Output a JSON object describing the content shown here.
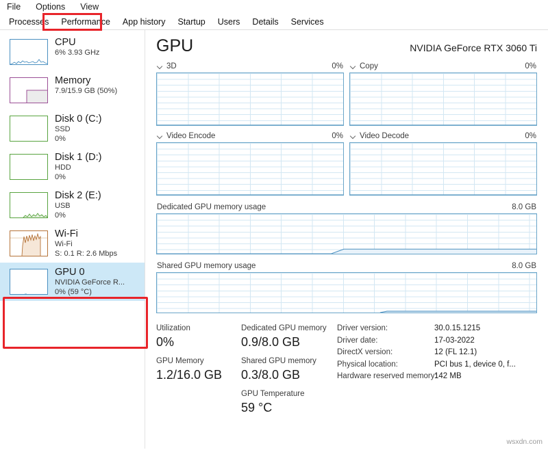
{
  "window": {
    "menu": [
      {
        "label": "File",
        "name": "menu-file"
      },
      {
        "label": "Options",
        "name": "menu-options"
      },
      {
        "label": "View",
        "name": "menu-view"
      }
    ],
    "tabs": [
      {
        "label": "Processes",
        "name": "tab-processes",
        "active": false
      },
      {
        "label": "Performance",
        "name": "tab-performance",
        "active": true
      },
      {
        "label": "App history",
        "name": "tab-app-history",
        "active": false
      },
      {
        "label": "Startup",
        "name": "tab-startup",
        "active": false
      },
      {
        "label": "Users",
        "name": "tab-users",
        "active": false
      },
      {
        "label": "Details",
        "name": "tab-details",
        "active": false
      },
      {
        "label": "Services",
        "name": "tab-services",
        "active": false
      }
    ],
    "annotation_color": "#e8242a",
    "watermark": "wsxdn.com"
  },
  "sidebar": {
    "items": [
      {
        "name": "sidebar-item-cpu",
        "title": "CPU",
        "sub1": "6%  3.93 GHz",
        "sub2": "",
        "accent": "#4a8fc0",
        "fill": "#cfe4f2",
        "selected": false,
        "graph": "spiky-low"
      },
      {
        "name": "sidebar-item-memory",
        "title": "Memory",
        "sub1": "7.9/15.9 GB (50%)",
        "sub2": "",
        "accent": "#9b4f96",
        "fill": "#ececec",
        "selected": false,
        "graph": "memory-block"
      },
      {
        "name": "sidebar-item-disk0",
        "title": "Disk 0 (C:)",
        "sub1": "SSD",
        "sub2": "0%",
        "accent": "#58a33f",
        "fill": "#e3f0dd",
        "selected": false,
        "graph": "flat"
      },
      {
        "name": "sidebar-item-disk1",
        "title": "Disk 1 (D:)",
        "sub1": "HDD",
        "sub2": "0%",
        "accent": "#58a33f",
        "fill": "#e3f0dd",
        "selected": false,
        "graph": "flat"
      },
      {
        "name": "sidebar-item-disk2",
        "title": "Disk 2 (E:)",
        "sub1": "USB",
        "sub2": "0%",
        "accent": "#58a33f",
        "fill": "#e3f0dd",
        "selected": false,
        "graph": "small-bumps"
      },
      {
        "name": "sidebar-item-wifi",
        "title": "Wi-Fi",
        "sub1": "Wi-Fi",
        "sub2": "S: 0.1 R: 2.6 Mbps",
        "accent": "#b5743a",
        "fill": "#f6e7d8",
        "selected": false,
        "graph": "wifi-burst"
      },
      {
        "name": "sidebar-item-gpu0",
        "title": "GPU 0",
        "sub1": "NVIDIA GeForce R...",
        "sub2": "0%  (59 °C)",
        "accent": "#4a8fc0",
        "fill": "#cfe4f2",
        "selected": true,
        "graph": "flat"
      }
    ]
  },
  "main": {
    "title": "GPU",
    "device": "NVIDIA GeForce RTX 3060 Ti",
    "engine_graphs": [
      {
        "name": "graph-3d",
        "label": "3D",
        "value": "0%"
      },
      {
        "name": "graph-copy",
        "label": "Copy",
        "value": "0%"
      },
      {
        "name": "graph-video-encode",
        "label": "Video Encode",
        "value": "0%"
      },
      {
        "name": "graph-video-decode",
        "label": "Video Decode",
        "value": "0%"
      }
    ],
    "memory_graphs": [
      {
        "name": "graph-dedicated-gpu-memory",
        "label": "Dedicated GPU memory usage",
        "max": "8.0 GB"
      },
      {
        "name": "graph-shared-gpu-memory",
        "label": "Shared GPU memory usage",
        "max": "8.0 GB"
      }
    ],
    "stats_col1": [
      {
        "name": "stat-utilization",
        "label": "Utilization",
        "value": "0%"
      },
      {
        "name": "stat-gpu-memory",
        "label": "GPU Memory",
        "value": "1.2/16.0 GB"
      }
    ],
    "stats_col2": [
      {
        "name": "stat-dedicated-gpu-memory",
        "label": "Dedicated GPU memory",
        "value": "0.9/8.0 GB"
      },
      {
        "name": "stat-shared-gpu-memory",
        "label": "Shared GPU memory",
        "value": "0.3/8.0 GB"
      },
      {
        "name": "stat-gpu-temperature",
        "label": "GPU Temperature",
        "value": "59 °C"
      }
    ],
    "details": [
      {
        "name": "detail-driver-version",
        "key": "Driver version:",
        "value": "30.0.15.1215"
      },
      {
        "name": "detail-driver-date",
        "key": "Driver date:",
        "value": "17-03-2022"
      },
      {
        "name": "detail-directx-version",
        "key": "DirectX version:",
        "value": "12 (FL 12.1)"
      },
      {
        "name": "detail-physical-location",
        "key": "Physical location:",
        "value": "PCI bus 1, device 0, f..."
      },
      {
        "name": "detail-hardware-reserved-memory",
        "key": "Hardware reserved memory:",
        "value": "142 MB"
      }
    ]
  },
  "chart_data": {
    "type": "line",
    "title": "GPU performance graphs",
    "panels": [
      {
        "label": "3D",
        "ylim": [
          0,
          100
        ],
        "ylabel": "%",
        "current": 0,
        "values": [
          0,
          0,
          0,
          0,
          0,
          0,
          0,
          0,
          0,
          0,
          0,
          0,
          0,
          0,
          0,
          0,
          0,
          0,
          0,
          0
        ]
      },
      {
        "label": "Copy",
        "ylim": [
          0,
          100
        ],
        "ylabel": "%",
        "current": 0,
        "values": [
          0,
          0,
          0,
          0,
          0,
          0,
          0,
          0,
          0,
          0,
          0,
          0,
          0,
          0,
          0,
          0,
          0,
          0,
          0,
          0
        ]
      },
      {
        "label": "Video Encode",
        "ylim": [
          0,
          100
        ],
        "ylabel": "%",
        "current": 0,
        "values": [
          0,
          0,
          0,
          0,
          0,
          0,
          0,
          0,
          0,
          0,
          0,
          0,
          0,
          0,
          0,
          0,
          0,
          0,
          0,
          0
        ]
      },
      {
        "label": "Video Decode",
        "ylim": [
          0,
          100
        ],
        "ylabel": "%",
        "current": 0,
        "values": [
          0,
          0,
          0,
          0,
          0,
          0,
          0,
          0,
          0,
          0,
          0,
          0,
          0,
          0,
          0,
          0,
          0,
          0,
          0,
          0
        ]
      },
      {
        "label": "Dedicated GPU memory usage",
        "ylim": [
          0,
          8
        ],
        "ylabel": "GB",
        "current": 0.9,
        "values": [
          0,
          0,
          0,
          0,
          0,
          0,
          0,
          0,
          0,
          0,
          0.9,
          0.9,
          0.9,
          0.9,
          0.9,
          0.9,
          0.9,
          0.9,
          0.9,
          0.9
        ]
      },
      {
        "label": "Shared GPU memory usage",
        "ylim": [
          0,
          8
        ],
        "ylabel": "GB",
        "current": 0.3,
        "values": [
          0,
          0,
          0,
          0,
          0,
          0,
          0,
          0,
          0,
          0,
          0,
          0,
          0,
          0.3,
          0.3,
          0.3,
          0.3,
          0.3,
          0.3,
          0.3
        ]
      }
    ],
    "grid": true,
    "legend": "none"
  }
}
